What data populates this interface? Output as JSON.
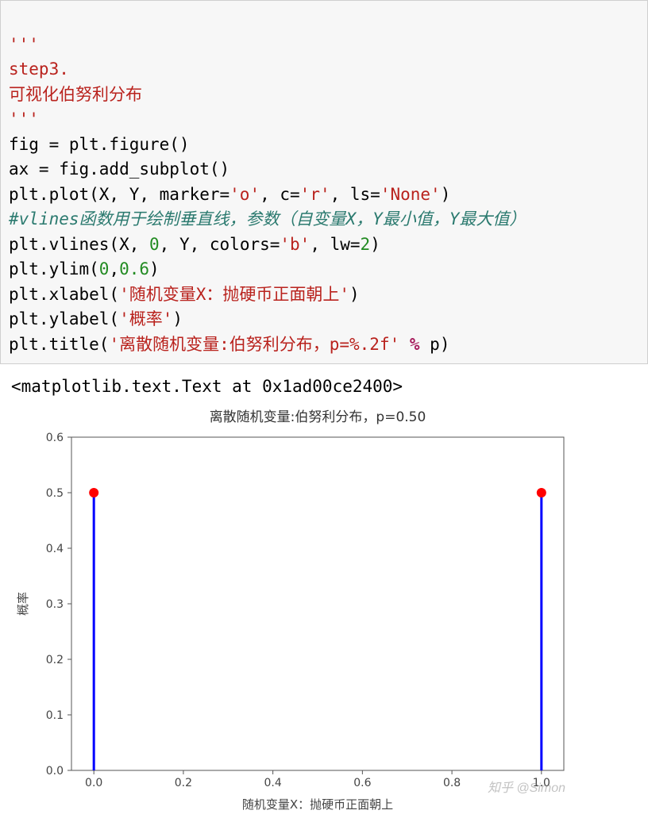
{
  "code": {
    "line1": "'''",
    "line2": "step3.",
    "line3": "可视化伯努利分布",
    "line4": "'''",
    "line5a": "fig = plt.figure()",
    "line6a": "ax = fig.add_subplot()",
    "line7_pre": "plt.plot(X, Y, marker=",
    "line7_s1": "'o'",
    "line7_mid1": ", c=",
    "line7_s2": "'r'",
    "line7_mid2": ", ls=",
    "line7_s3": "'None'",
    "line7_post": ")",
    "line8": "#vlines函数用于绘制垂直线，参数（自变量X，Y最小值，Y最大值）",
    "line9_pre": "plt.vlines(X, ",
    "line9_n1": "0",
    "line9_mid1": ", Y, colors=",
    "line9_s1": "'b'",
    "line9_mid2": ", lw=",
    "line9_n2": "2",
    "line9_post": ")",
    "line10_pre": "plt.ylim(",
    "line10_n1": "0",
    "line10_mid": ",",
    "line10_n2": "0.6",
    "line10_post": ")",
    "line11_pre": "plt.xlabel(",
    "line11_s": "'随机变量X：抛硬币正面朝上'",
    "line11_post": ")",
    "line12_pre": "plt.ylabel(",
    "line12_s": "'概率'",
    "line12_post": ")",
    "line13_pre": "plt.title(",
    "line13_s": "'离散随机变量:伯努利分布，p=%.2f'",
    "line13_op": " % ",
    "line13_post": "p)"
  },
  "output_text": "<matplotlib.text.Text at 0x1ad00ce2400>",
  "watermark": "知乎 @Simon",
  "chart_data": {
    "type": "bar",
    "title": "离散随机变量:伯努利分布，p=0.50",
    "xlabel": "随机变量X：抛硬币正面朝上",
    "ylabel": "概率",
    "x": [
      0,
      1
    ],
    "y": [
      0.5,
      0.5
    ],
    "xlim": [
      -0.05,
      1.05
    ],
    "ylim": [
      0,
      0.6
    ],
    "xticks": [
      0.0,
      0.2,
      0.4,
      0.6,
      0.8,
      1.0
    ],
    "yticks": [
      0.0,
      0.1,
      0.2,
      0.3,
      0.4,
      0.5,
      0.6
    ],
    "marker_color": "#ff0000",
    "line_color": "#0000ff"
  }
}
